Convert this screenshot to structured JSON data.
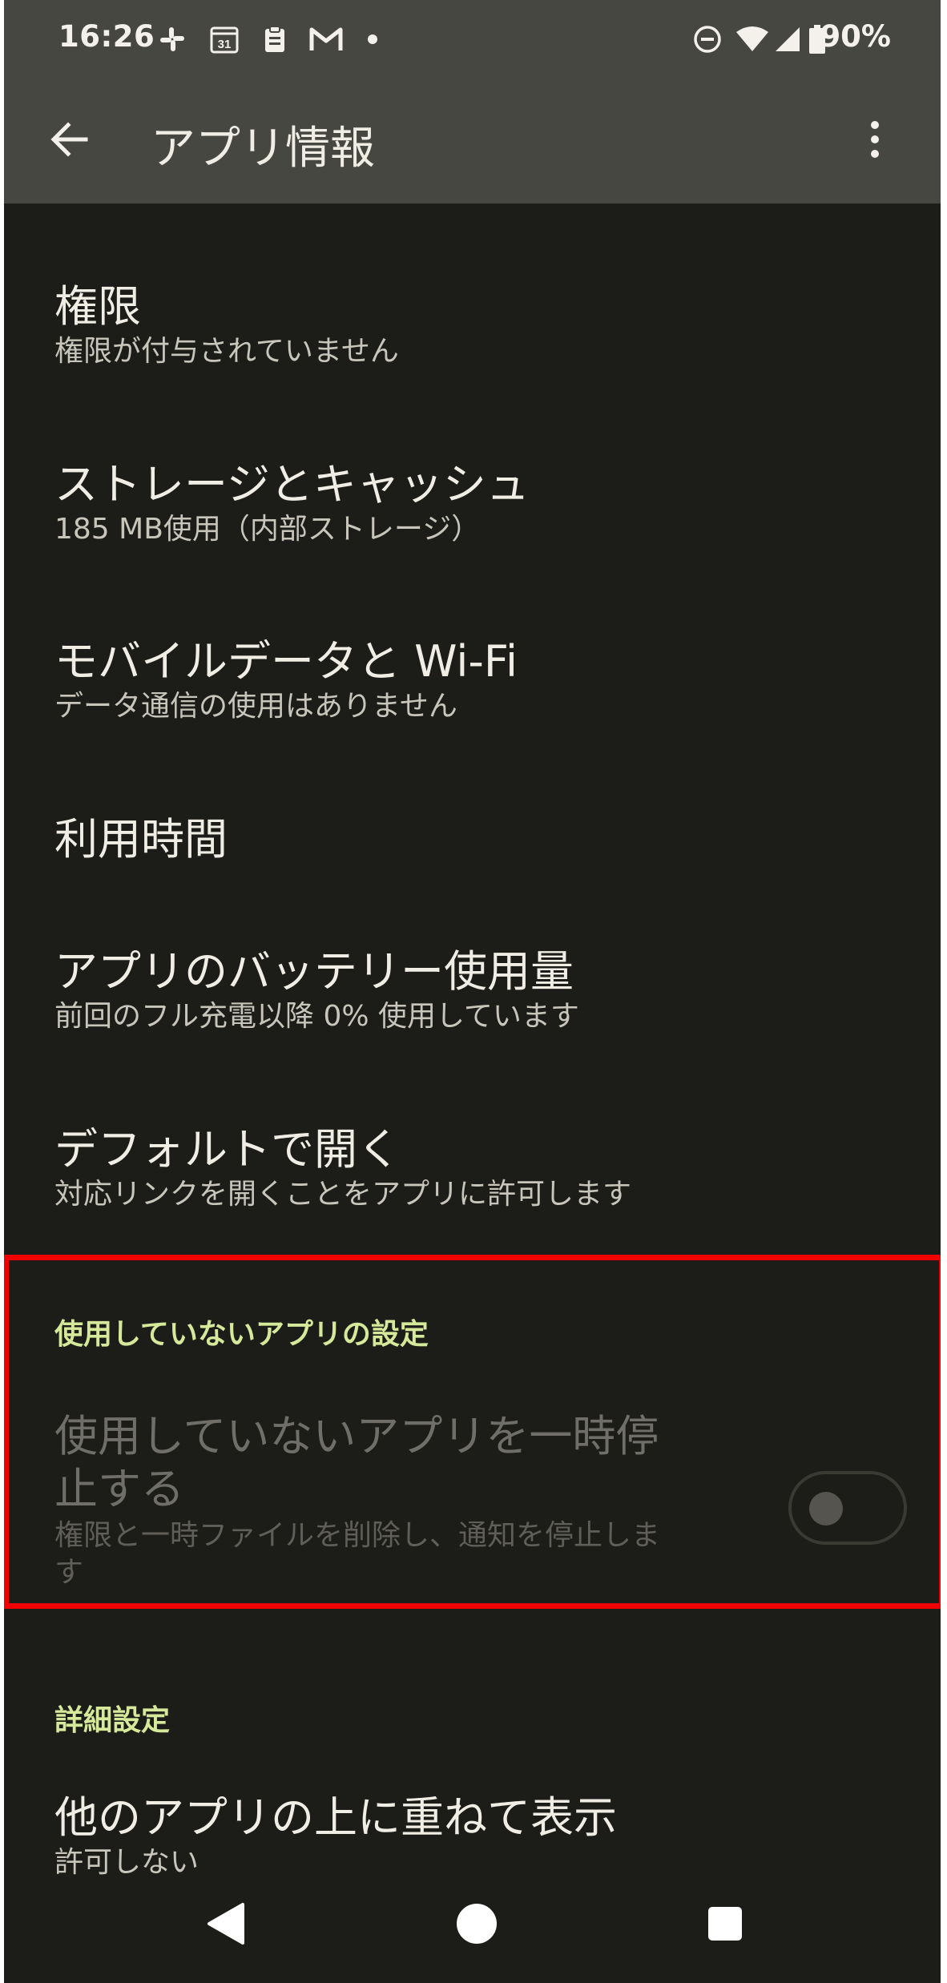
{
  "status_bar": {
    "time": "16:26",
    "battery": "90%",
    "icons": [
      "slack-icon",
      "calendar-icon",
      "clipboard-icon",
      "gmail-icon",
      "dot-icon",
      "dnd-icon",
      "wifi-icon",
      "signal-icon",
      "battery-icon"
    ],
    "calendar_day": "31"
  },
  "app_bar": {
    "title": "アプリ情報",
    "back_icon": "arrow-back-icon",
    "more_icon": "more-vert-icon"
  },
  "items": [
    {
      "primary": "権限",
      "secondary": "権限が付与されていません"
    },
    {
      "primary": "ストレージとキャッシュ",
      "secondary": "185 MB使用（内部ストレージ）"
    },
    {
      "primary": "モバイルデータと Wi-Fi",
      "secondary": "データ通信の使用はありません"
    },
    {
      "primary": "利用時間",
      "secondary": ""
    },
    {
      "primary": "アプリのバッテリー使用量",
      "secondary": "前回のフル充電以降 0% 使用しています"
    },
    {
      "primary": "デフォルトで開く",
      "secondary": "対応リンクを開くことをアプリに許可します"
    }
  ],
  "unused_section": {
    "header": "使用していないアプリの設定",
    "setting_title_line1": "使用していないアプリを一時停",
    "setting_title_line2": "止する",
    "setting_desc_line1": "権限と一時ファイルを削除し、通知を停止しま",
    "setting_desc_line2": "す",
    "toggle_on": false,
    "enabled": false
  },
  "advanced_section": {
    "header": "詳細設定",
    "items": [
      {
        "primary": "他のアプリの上に重ねて表示",
        "secondary": "許可しない"
      }
    ]
  },
  "nav_bar": {
    "buttons": [
      "back-triangle-icon",
      "home-circle-icon",
      "recents-square-icon"
    ]
  },
  "colors": {
    "background": "#1c1c18",
    "top_bar": "#474741",
    "section_header": "#d6e89a",
    "highlight": "#f00000"
  }
}
